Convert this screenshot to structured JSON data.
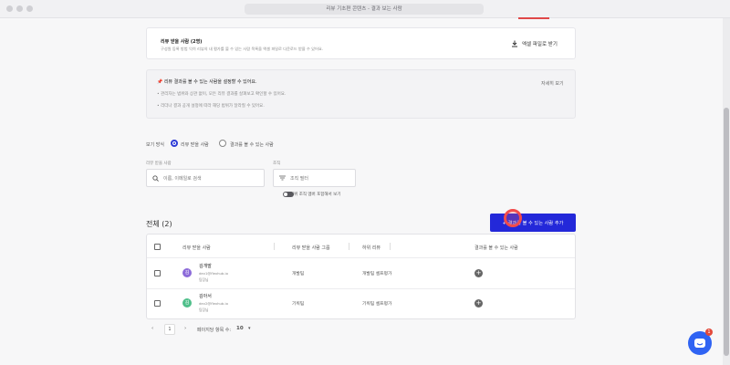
{
  "window": {
    "url": "리뷰 기초편 콘텐츠 - 결과 보는 사람"
  },
  "info": {
    "title": "리뷰 받을 사람 (2명)",
    "subtitle": "구성원 등록 방법 익히 리뷰의 내 평가를 볼 수 있는 사람 목록을 엑셀 파일로 다운로드 받을 수 있어요.",
    "excel_label": "엑셀 파일로 받기"
  },
  "notice": {
    "title": "리뷰 결과를 볼 수 있는 사람을 설정할 수 있어요.",
    "lines": [
      "관리자는 범위와 상관 없이, 모든 리뷰 결과를 살펴보고 확인할 수 있어요.",
      "리더나 결과 공개 설정에 따라 해당 범위가 달라질 수 있어요."
    ],
    "more": "자세히 보기"
  },
  "view": {
    "label": "보기 방식",
    "option1": "리뷰 받을 사람",
    "option2": "결과를 볼 수 있는 사람",
    "selected": "리뷰 받을 사람"
  },
  "filters": {
    "search_label": "리뷰 받을 사람",
    "search_placeholder": "이름, 이메일로 검색",
    "org_label": "조직",
    "org_value": "조직 필터",
    "toggle_label": "하위 조직 멤버 포함해서 보기"
  },
  "list": {
    "total": "전체 (2)",
    "add_button": "+ 결과를 볼 수 있는 사람 추가",
    "columns": [
      "리뷰 받을 사람",
      "리뷰 받을 사람 그룹",
      "하위 리뷰",
      "결과를 볼 수 있는 사람"
    ],
    "rows": [
      {
        "avatar": "김",
        "name": "김개발",
        "email": "dev1@flexhub.io",
        "role": "팀장님",
        "group": "개발팀",
        "review": "개발팀 셀프평가"
      },
      {
        "avatar": "김",
        "name": "김아서",
        "email": "dev2@flexhub.io",
        "role": "팀장님",
        "group": "기획팀",
        "review": "기획팀 셀프평가"
      }
    ],
    "avatar_colors": [
      "#8c6bd9",
      "#4fbf8a"
    ]
  },
  "pagination": {
    "current_page": "1",
    "per_page_label": "페이지당 항목 수:",
    "per_page_value": "10"
  },
  "chat": {
    "badge": "1"
  }
}
